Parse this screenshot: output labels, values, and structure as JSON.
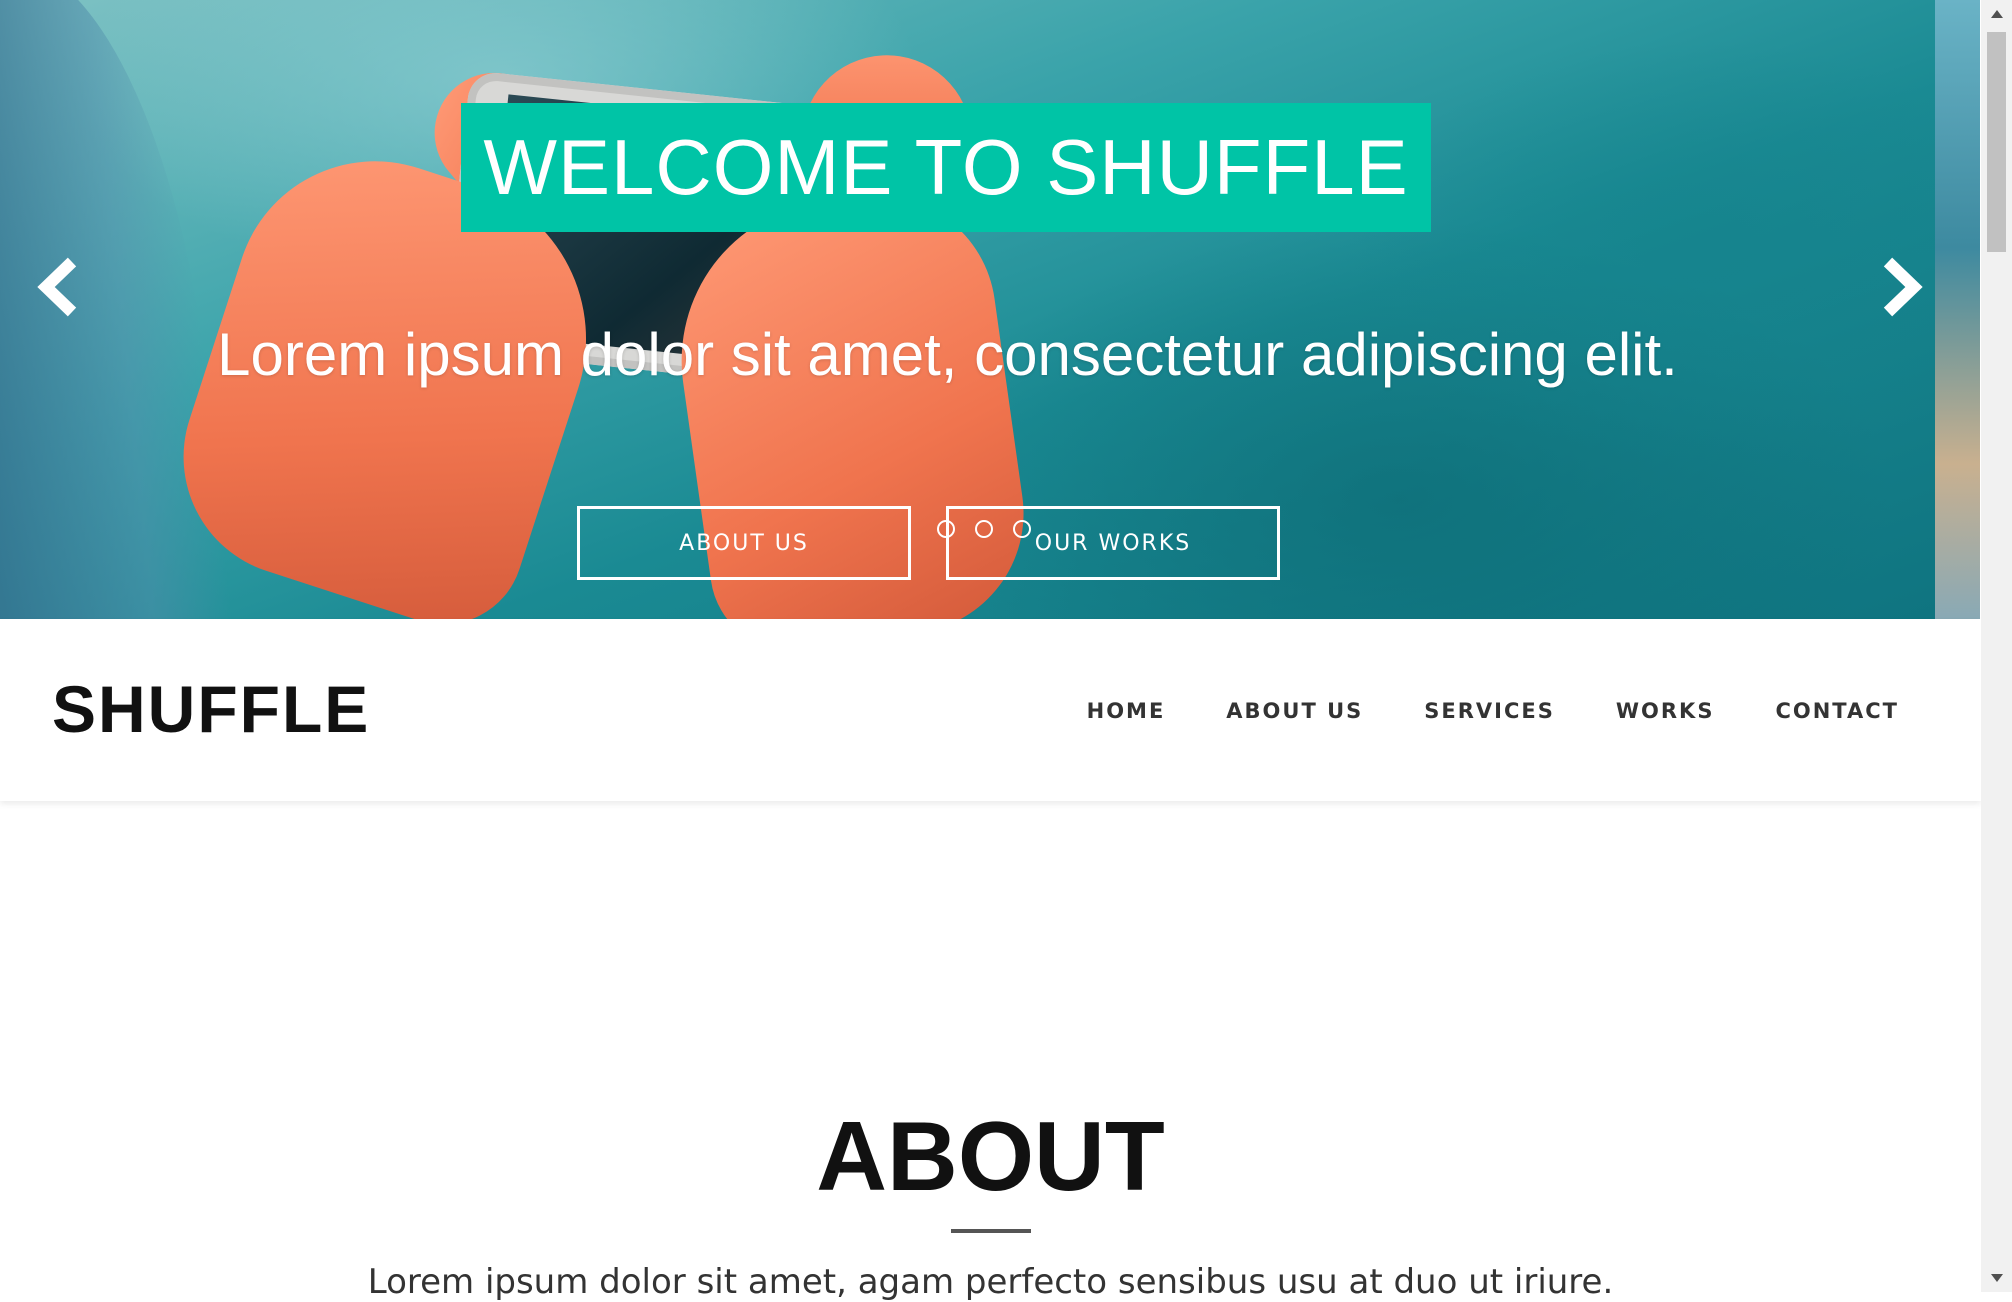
{
  "hero": {
    "title": "WELCOME TO SHUFFLE",
    "subtitle": "Lorem ipsum dolor sit amet, consectetur adipiscing elit.",
    "buttons": [
      "ABOUT US",
      "OUR WORKS"
    ],
    "slide_count": 3,
    "accent_color": "#00c4a6",
    "prev_icon": "chevron-left-icon",
    "next_icon": "chevron-right-icon"
  },
  "navbar": {
    "brand": "SHUFFLE",
    "items": [
      "HOME",
      "ABOUT US",
      "SERVICES",
      "WORKS",
      "CONTACT"
    ]
  },
  "about": {
    "title": "ABOUT",
    "text": "Lorem ipsum dolor sit amet, agam perfecto sensibus usu at duo ut iriure."
  }
}
